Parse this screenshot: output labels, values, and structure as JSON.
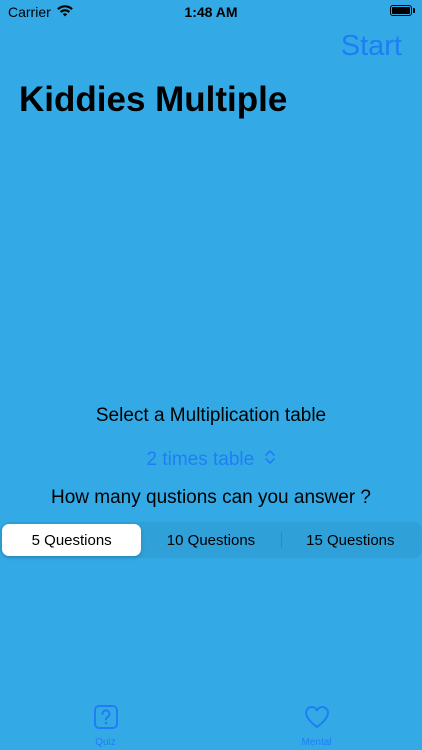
{
  "status_bar": {
    "carrier": "Carrier",
    "time": "1:48 AM"
  },
  "nav": {
    "start_label": "Start"
  },
  "header": {
    "title": "Kiddies Multiple"
  },
  "main": {
    "select_label": "Select a Multiplication table",
    "picker_value": "2 times table",
    "questions_label": "How many qustions can you answer ?",
    "segments": [
      {
        "label": "5 Questions",
        "selected": true
      },
      {
        "label": "10 Questions",
        "selected": false
      },
      {
        "label": "15 Questions",
        "selected": false
      }
    ]
  },
  "tab_bar": {
    "tabs": [
      {
        "label": "Quiz",
        "icon": "question-square-icon"
      },
      {
        "label": "Mental",
        "icon": "heart-icon"
      }
    ]
  },
  "colors": {
    "background": "#33AAE6",
    "accent": "#1F7EF5"
  }
}
